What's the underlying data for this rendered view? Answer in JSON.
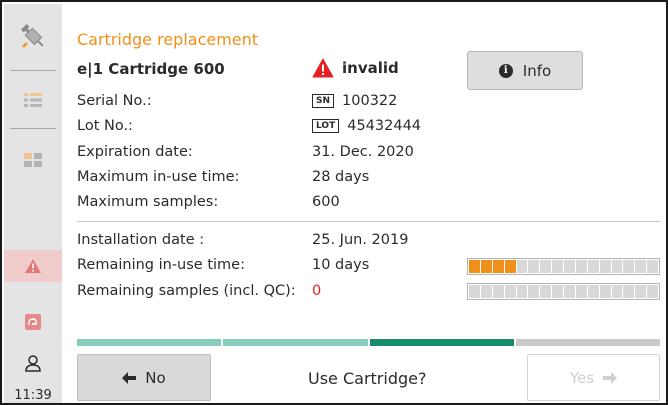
{
  "sidebar": {
    "time": "11:39",
    "icons": [
      "syringe-icon",
      "list-icon",
      "grid-icon",
      "warning-icon",
      "cartridge-icon",
      "user-icon"
    ]
  },
  "header": {
    "title": "Cartridge replacement",
    "cartridge_name": "e|1 Cartridge 600",
    "status_label": "invalid",
    "info_label": "Info"
  },
  "details": [
    {
      "key": "Serial No.:",
      "tag": "SN",
      "value": "100322"
    },
    {
      "key": "Lot No.:",
      "tag": "LOT",
      "value": "45432444"
    },
    {
      "key": "Expiration date:",
      "value": "31. Dec. 2020"
    },
    {
      "key": "Maximum in-use time:",
      "value": "28 days"
    },
    {
      "key": "Maximum samples:",
      "value": "600"
    }
  ],
  "usage": [
    {
      "key": "Installation date :",
      "value": "25. Jun. 2019"
    },
    {
      "key": "Remaining in-use time:",
      "value": "10 days",
      "fill": 0.25
    },
    {
      "key": "Remaining samples (incl. QC):",
      "value": "0",
      "fill": 0
    }
  ],
  "wizard_steps": [
    {
      "state": "done",
      "color": "#86cdbb"
    },
    {
      "state": "done",
      "color": "#86cdbb"
    },
    {
      "state": "active",
      "color": "#178c6b"
    },
    {
      "state": "pending",
      "color": "#c9c9c9"
    }
  ],
  "footer": {
    "no_label": "No",
    "question": "Use Cartridge?",
    "yes_label": "Yes"
  },
  "colors": {
    "accent": "#f0901a",
    "alert": "#e32222",
    "step_done": "#86cdbb",
    "step_active": "#178c6b"
  }
}
